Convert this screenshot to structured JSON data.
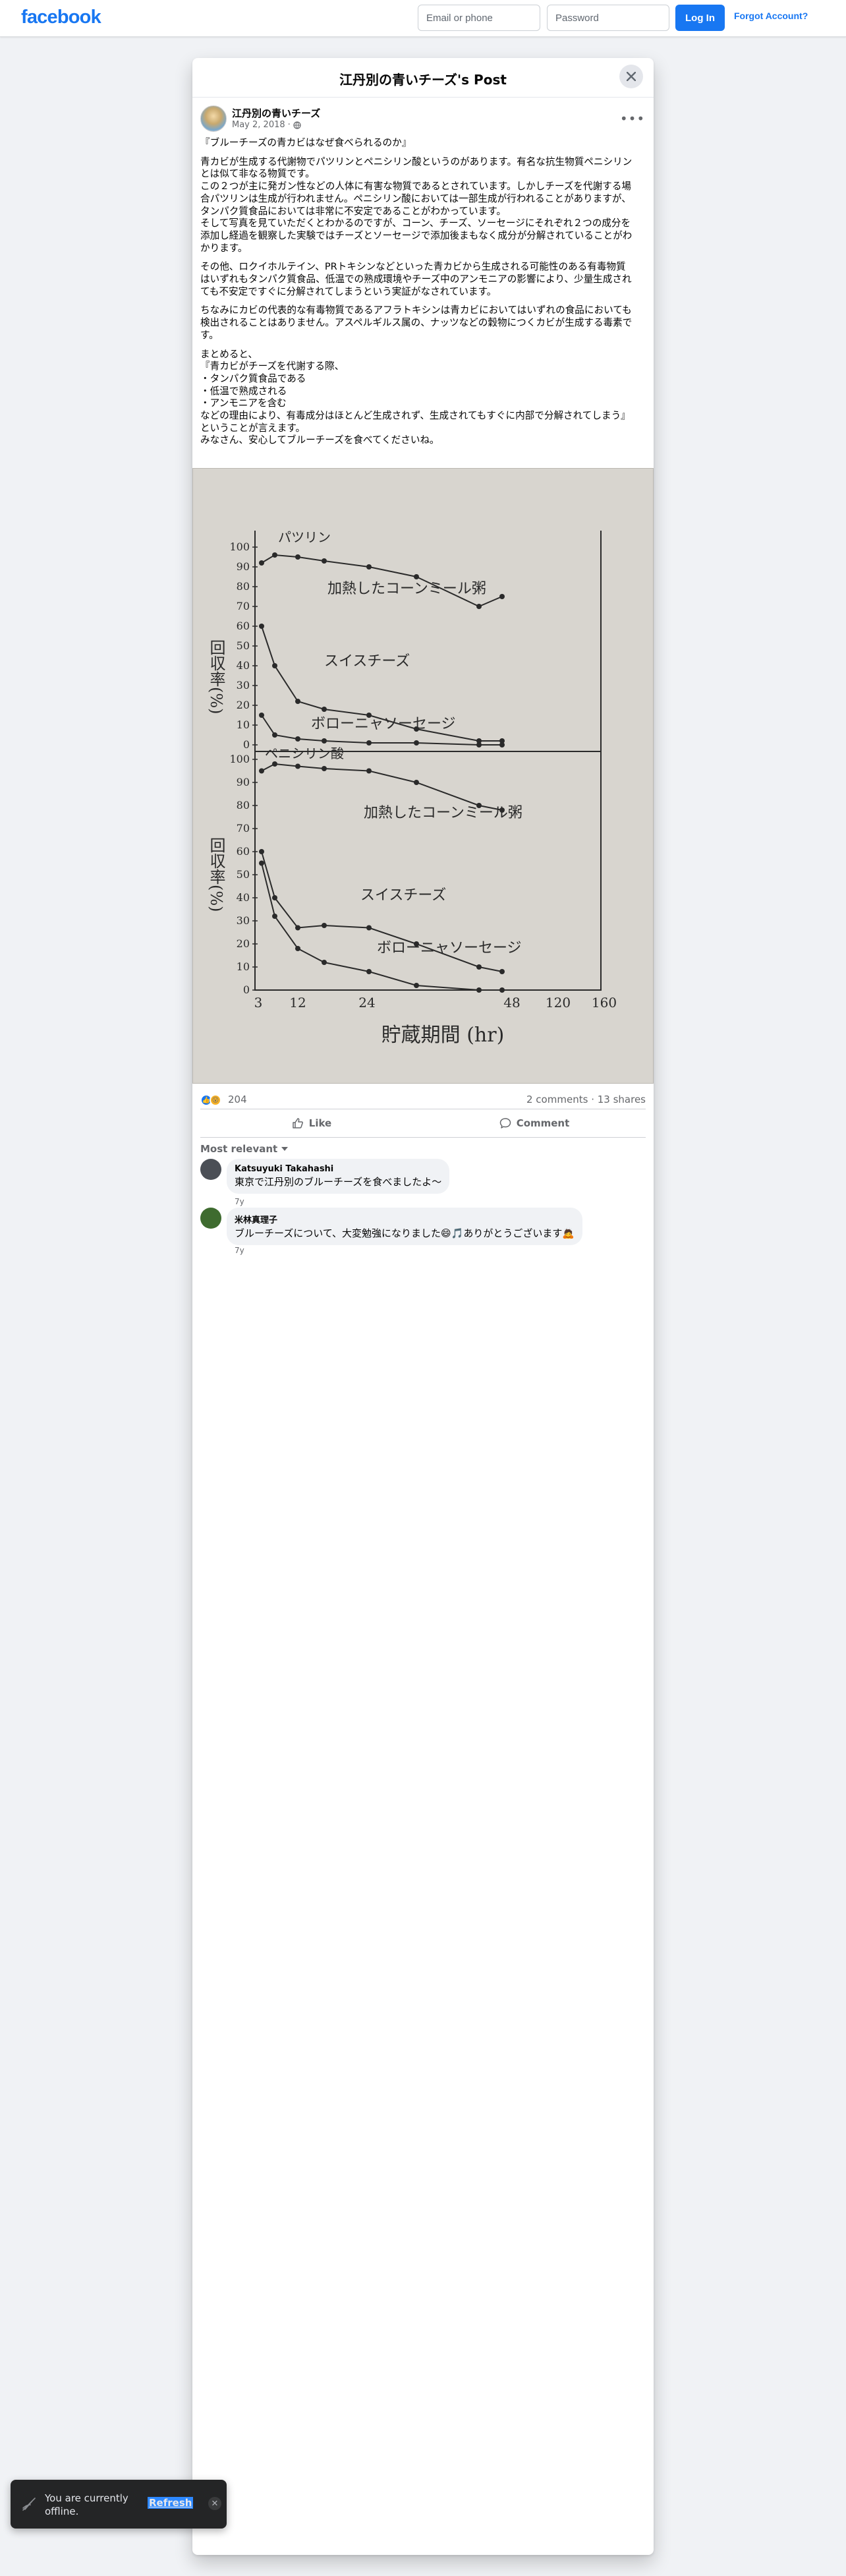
{
  "topbar": {
    "logo": "facebook",
    "email_placeholder": "Email or phone",
    "password_placeholder": "Password",
    "login_label": "Log In",
    "forgot_label": "Forgot Account?"
  },
  "dialog": {
    "title": "江丹別の青いチーズ's Post",
    "close_icon": "close-icon"
  },
  "post": {
    "author": "江丹別の青いチーズ",
    "date": "May 2, 2018",
    "privacy_icon": "globe-icon",
    "paragraphs": [
      [
        "『ブルーチーズの青カビはなぜ食べられるのか』"
      ],
      [
        "青カビが生成する代謝物でパツリンとペニシリン酸というのがあります。有名な抗生物質ペニシリン",
        "とは似て非なる物質です。",
        "この２つが主に発ガン性などの人体に有害な物質であるとされています。しかしチーズを代謝する場",
        "合パツリンは生成が行われません。ペニシリン酸においては一部生成が行われることがありますが、",
        "タンパク質食品においては非常に不安定であることがわかっています。",
        "そして写真を見ていただくとわかるのですが、コーン、チーズ、ソーセージにそれぞれ２つの成分を",
        "添加し経過を観察した実験ではチーズとソーセージで添加後まもなく成分が分解されていることがわ",
        "かります。"
      ],
      [
        "その他、ロクイホルテイン、PRトキシンなどといった青カビから生成される可能性のある有毒物質",
        "はいずれもタンパク質食品、低温での熟成環境やチーズ中のアンモニアの影響により、少量生成され",
        "ても不安定ですぐに分解されてしまうという実証がなされています。"
      ],
      [
        "ちなみにカビの代表的な有毒物質であるアフラトキシンは青カビにおいてはいずれの食品においても",
        "検出されることはありません。アスペルギルス属の、ナッツなどの穀物につくカビが生成する毒素で",
        "す。"
      ],
      [
        "まとめると、",
        "『青カビがチーズを代謝する際、",
        "・タンパク質食品である",
        "・低温で熟成される",
        "・アンモニアを含む",
        "などの理由により、有毒成分はほとんど生成されず、生成されてもすぐに内部で分解されてしまう』",
        "ということが言えます。",
        "みなさん、安心してブルーチーズを食べてくださいね。"
      ]
    ],
    "image": {
      "chart_data": [
        {
          "type": "line",
          "title": "パツリン",
          "ylabel": "回収率(%)",
          "xlabel": "貯蔵期間 (hr)",
          "x_ticks": [
            "3",
            "12",
            "24",
            "48",
            "120",
            "160"
          ],
          "y_ticks": [
            0,
            10,
            20,
            30,
            40,
            50,
            60,
            70,
            80,
            90,
            100
          ],
          "series": [
            {
              "name": "加熱したコーンミール粥",
              "values": [
                92,
                96,
                95,
                93,
                90,
                85,
                70,
                75
              ]
            },
            {
              "name": "スイスチーズ",
              "values": [
                60,
                40,
                22,
                18,
                15,
                8,
                2,
                2
              ]
            },
            {
              "name": "ボローニャソーセージ",
              "values": [
                15,
                5,
                3,
                2,
                1,
                1,
                0,
                0
              ]
            }
          ]
        },
        {
          "type": "line",
          "title": "ペニシリン酸",
          "ylabel": "回収率(%)",
          "xlabel": "貯蔵期間 (hr)",
          "x_ticks": [
            "3",
            "12",
            "24",
            "48",
            "120",
            "160"
          ],
          "y_ticks": [
            0,
            10,
            20,
            30,
            40,
            50,
            60,
            70,
            80,
            90,
            100
          ],
          "series": [
            {
              "name": "加熱したコーンミール粥",
              "values": [
                95,
                98,
                97,
                96,
                95,
                90,
                80,
                78
              ]
            },
            {
              "name": "スイスチーズ",
              "values": [
                60,
                40,
                27,
                28,
                27,
                20,
                10,
                8
              ]
            },
            {
              "name": "ボローニャソーセージ",
              "values": [
                55,
                32,
                18,
                12,
                8,
                2,
                0,
                0
              ]
            }
          ]
        }
      ]
    }
  },
  "stats": {
    "reaction_count": "204",
    "comments": "2 comments",
    "separator": "·",
    "shares": "13 shares"
  },
  "actions": {
    "like": "Like",
    "comment": "Comment"
  },
  "sort_label": "Most relevant",
  "comments": [
    {
      "name": "Katsuyuki Takahashi",
      "text": "東京で江丹別のブルーチーズを食べましたよ〜",
      "time": "7y",
      "avatar_color": "#4b4f56"
    },
    {
      "name": "米林真理子",
      "text": "ブルーチーズについて、大変勉強になりました😄🎵ありがとうございます🙇",
      "time": "7y",
      "avatar_color": "#3e6b2f"
    }
  ],
  "toast": {
    "text": "You are currently offline.",
    "refresh": "Refresh"
  }
}
